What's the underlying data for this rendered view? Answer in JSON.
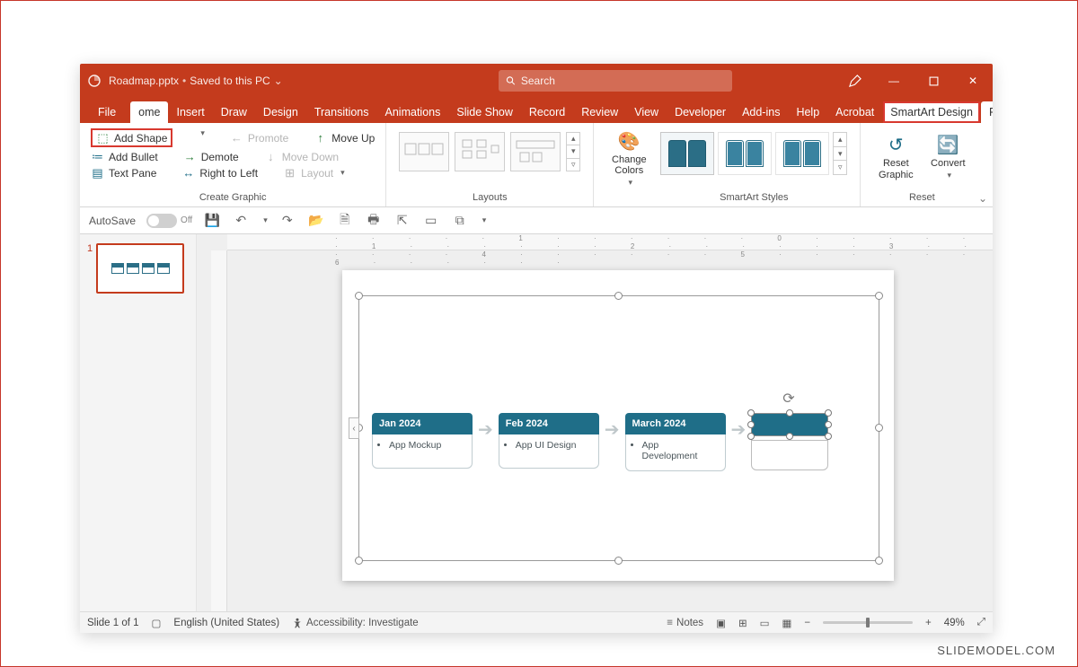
{
  "title": {
    "filename": "Roadmap.pptx",
    "saved": "Saved to this PC"
  },
  "search": {
    "placeholder": "Search"
  },
  "tabs": {
    "file": "File",
    "home": "ome",
    "insert": "Insert",
    "draw": "Draw",
    "design": "Design",
    "transitions": "Transitions",
    "animations": "Animations",
    "slideshow": "Slide Show",
    "record": "Record",
    "review": "Review",
    "view": "View",
    "developer": "Developer",
    "addins": "Add-ins",
    "help": "Help",
    "acrobat": "Acrobat",
    "smartart": "SmartArt Design",
    "format": "Format"
  },
  "ribbon": {
    "create": {
      "add_shape": "Add Shape",
      "add_bullet": "Add Bullet",
      "text_pane": "Text Pane",
      "promote": "Promote",
      "demote": "Demote",
      "rtl": "Right to Left",
      "move_up": "Move Up",
      "move_down": "Move Down",
      "layout": "Layout",
      "group_label": "Create Graphic"
    },
    "layouts_label": "Layouts",
    "change_colors": "Change Colors",
    "styles_label": "SmartArt Styles",
    "reset_graphic": "Reset Graphic",
    "convert": "Convert",
    "reset_label": "Reset"
  },
  "qat": {
    "autosave": "AutoSave",
    "autosave_state": "Off"
  },
  "thumb": {
    "num": "1"
  },
  "ruler": "· · · · · · 6 · · · · · · 5 · · · · · · 4 · · · · · · 3 · · · · · · 2 · · · · · · 1 · · · · · · 0 · · · · · · 1 · · · · · · 2 · · · · · · 3 · · · · · · 4 · · · · · · 5 · · · · · · 6 · · · · · ·",
  "roadmap": {
    "s1_head": "Jan 2024",
    "s1_item": "App Mockup",
    "s2_head": "Feb 2024",
    "s2_item": "App UI Design",
    "s3_head": "March 2024",
    "s3_item": "App Development"
  },
  "status": {
    "slide": "Slide 1 of 1",
    "lang": "English (United States)",
    "accessibility": "Accessibility: Investigate",
    "notes": "Notes",
    "zoom": "49%"
  },
  "watermark": "SLIDEMODEL.COM"
}
